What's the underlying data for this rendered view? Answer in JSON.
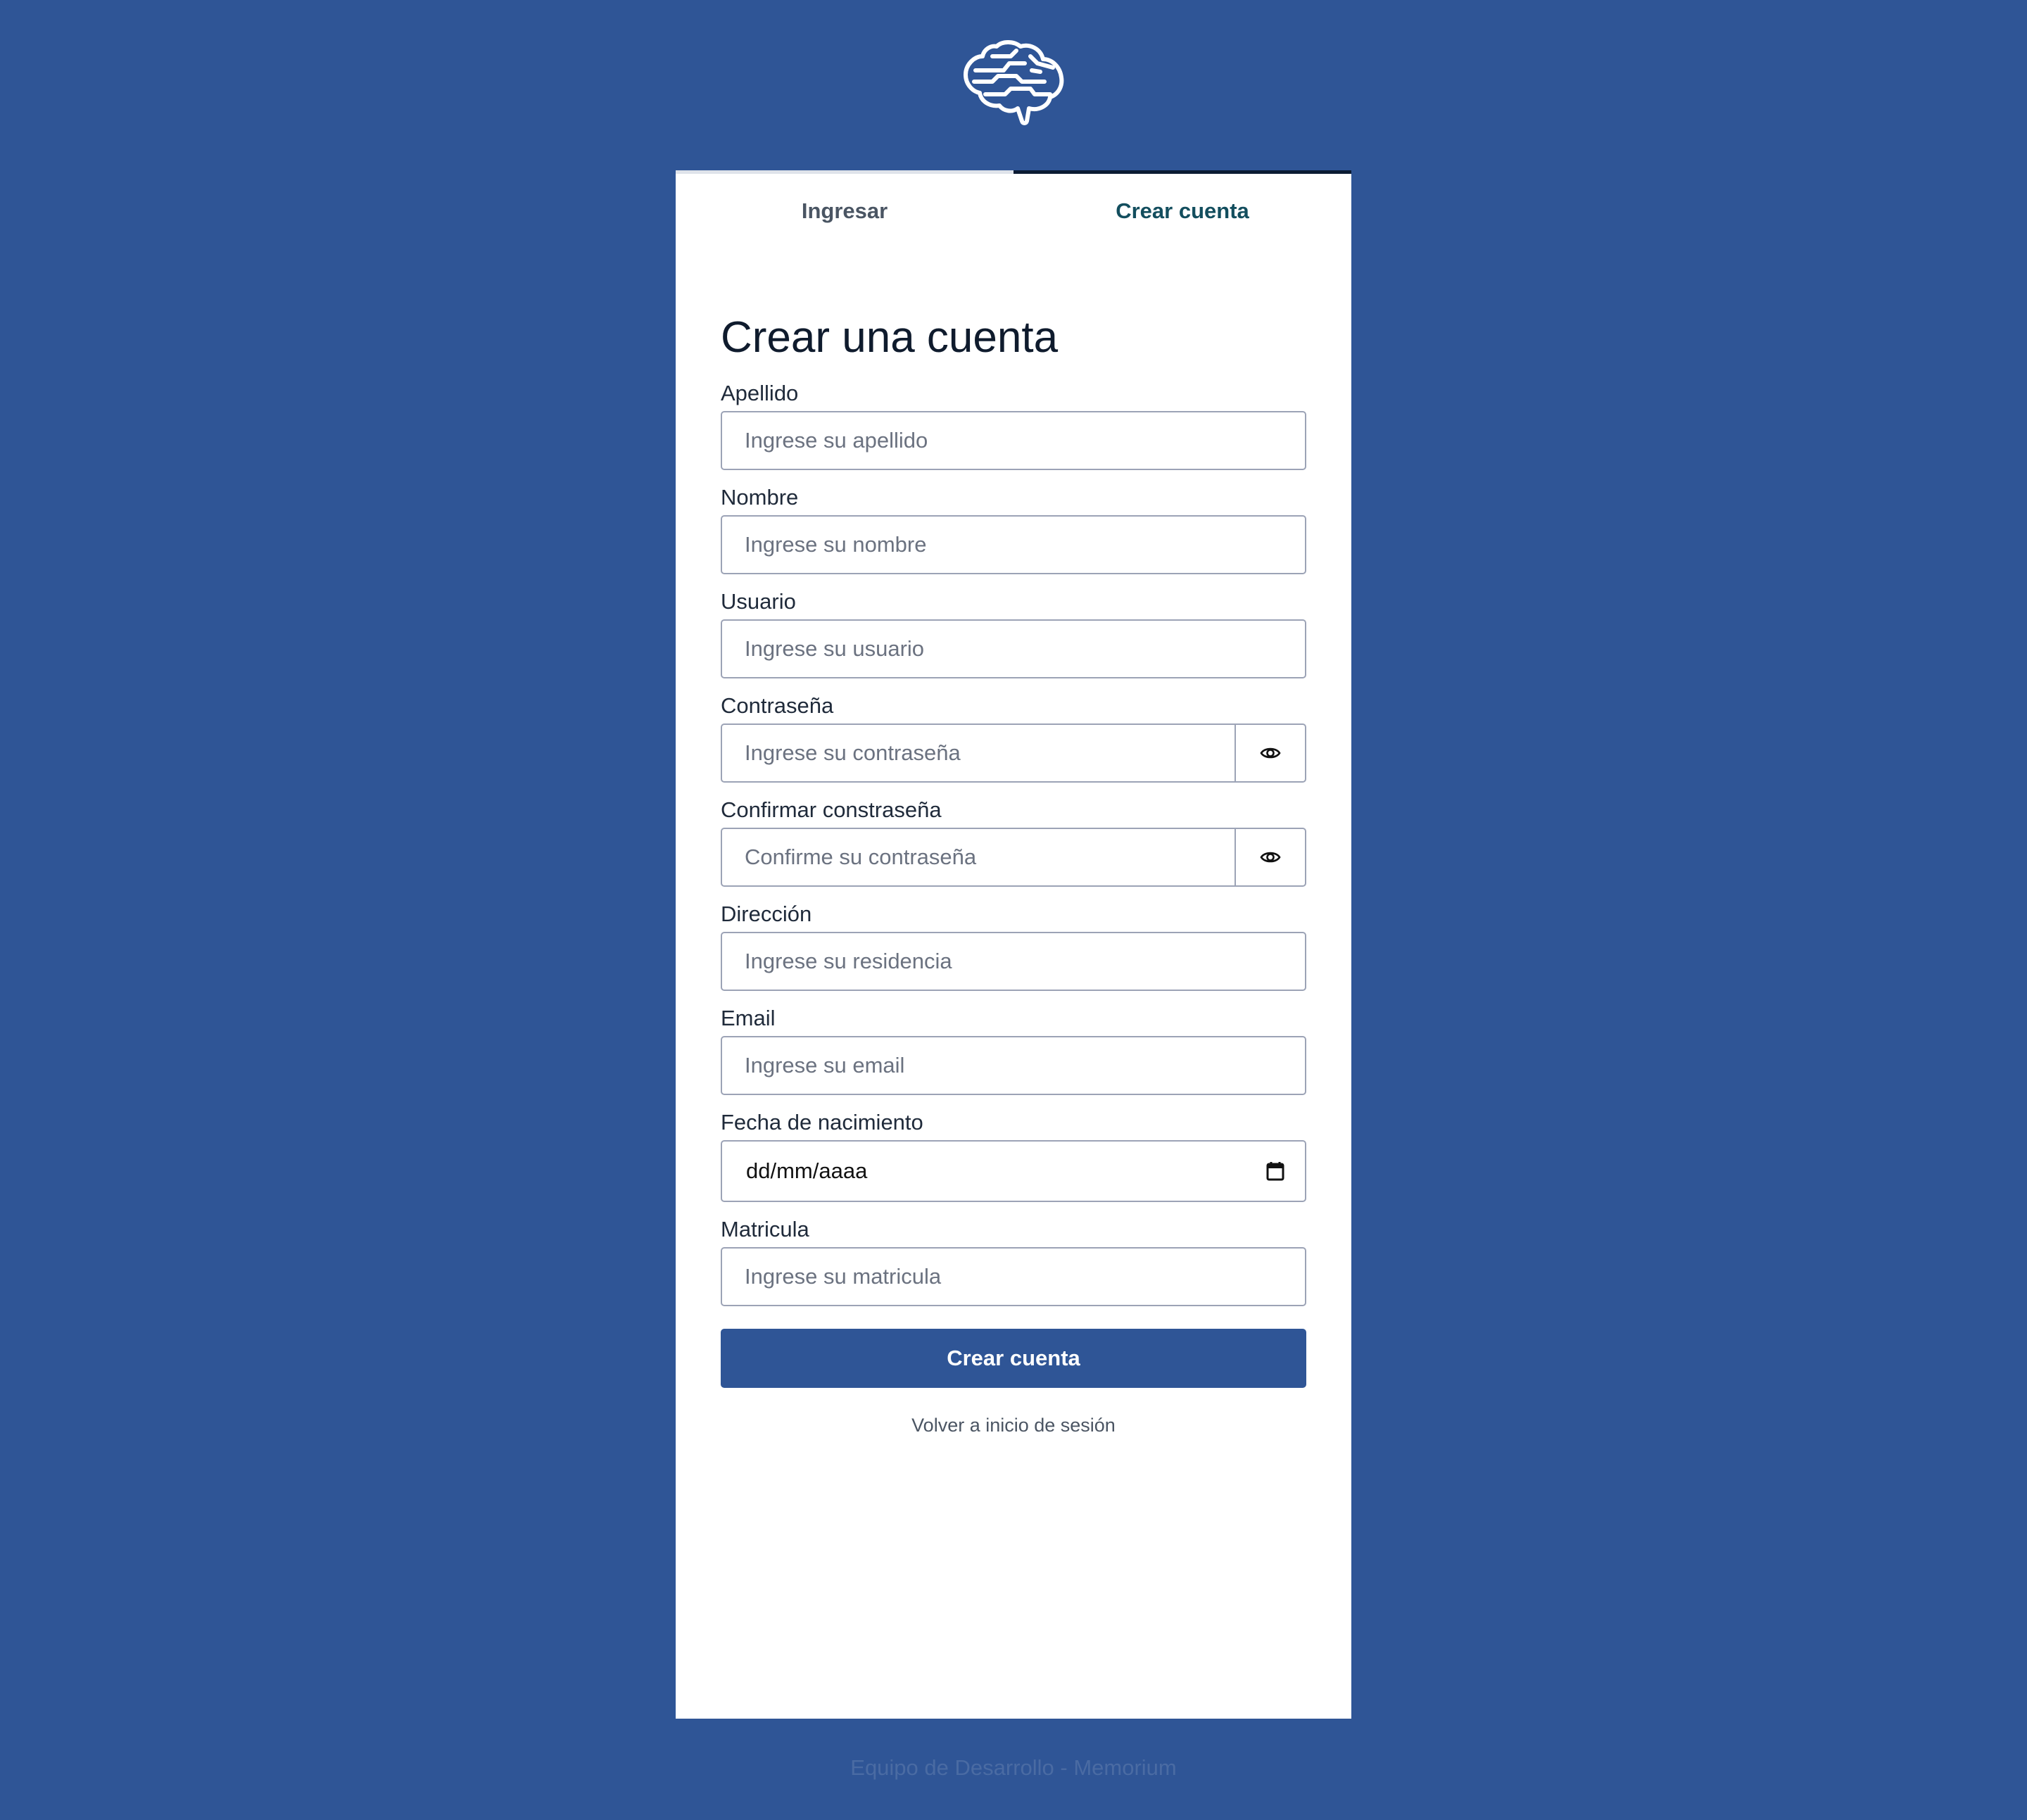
{
  "tabs": {
    "login_label": "Ingresar",
    "register_label": "Crear cuenta"
  },
  "form": {
    "title": "Crear una cuenta",
    "fields": {
      "apellido": {
        "label": "Apellido",
        "placeholder": "Ingrese su apellido"
      },
      "nombre": {
        "label": "Nombre",
        "placeholder": "Ingrese su nombre"
      },
      "usuario": {
        "label": "Usuario",
        "placeholder": "Ingrese su usuario"
      },
      "password": {
        "label": "Contraseña",
        "placeholder": "Ingrese su contraseña"
      },
      "confirm_password": {
        "label": "Confirmar constraseña",
        "placeholder": "Confirme su contraseña"
      },
      "direccion": {
        "label": "Dirección",
        "placeholder": "Ingrese su residencia"
      },
      "email": {
        "label": "Email",
        "placeholder": "Ingrese su email"
      },
      "fecha": {
        "label": "Fecha de nacimiento",
        "value": "dd/mm/aaaa"
      },
      "matricula": {
        "label": "Matricula",
        "placeholder": "Ingrese su matricula"
      }
    },
    "submit_label": "Crear cuenta",
    "back_link": "Volver a inicio de sesión"
  },
  "footer": {
    "text": "Equipo de Desarrollo - Memorium"
  },
  "icons": {
    "logo": "brain-icon",
    "password_toggle": "eye-icon",
    "date_picker": "calendar-icon"
  },
  "colors": {
    "background": "#2f5596",
    "primary_button": "#2f5596",
    "active_tab_text": "#134e5e",
    "card": "#ffffff"
  }
}
